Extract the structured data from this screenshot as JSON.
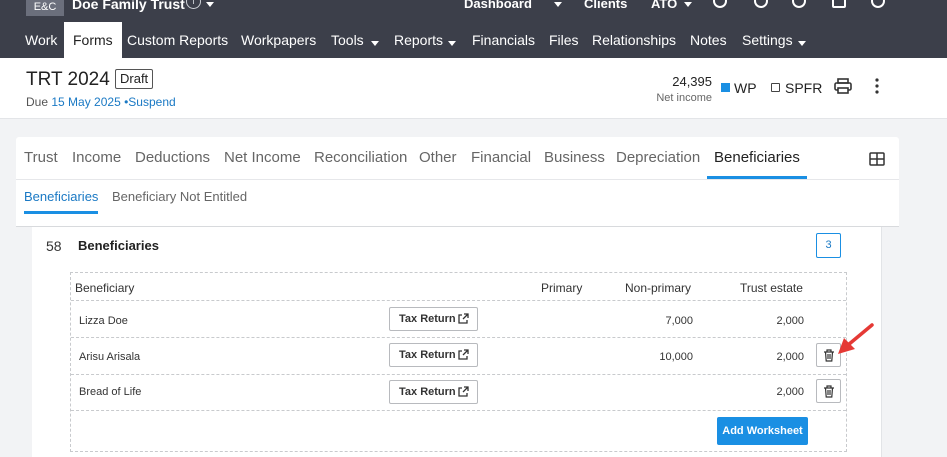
{
  "topbar": {
    "logo": "E&C",
    "client_name": "Doe Family Trust",
    "info_icon": "info-icon",
    "links": [
      "Dashboard",
      "Clients",
      "ATO"
    ]
  },
  "nav": {
    "items": [
      "Work",
      "Forms",
      "Custom Reports",
      "Workpapers",
      "Tools",
      "Reports",
      "Financials",
      "Files",
      "Relationships",
      "Notes",
      "Settings"
    ],
    "active": "Forms"
  },
  "header": {
    "title": "TRT 2024",
    "status": "Draft",
    "due_prefix": "Due",
    "due_date": "15 May 2025",
    "separator": "•",
    "suspend": "Suspend",
    "net_income_value": "24,395",
    "net_income_label": "Net income",
    "wp_label": "WP",
    "spfr_label": "SPFR",
    "accent_color": "#1a8fe3"
  },
  "tabs": {
    "items": [
      "Trust",
      "Income",
      "Deductions",
      "Net Income",
      "Reconciliation",
      "Other",
      "Financial",
      "Business",
      "Depreciation",
      "Beneficiaries"
    ],
    "active": "Beneficiaries"
  },
  "subtabs": {
    "items": [
      "Beneficiaries",
      "Beneficiary Not Entitled"
    ],
    "active": "Beneficiaries"
  },
  "section": {
    "number": "58",
    "title": "Beneficiaries",
    "count": "3",
    "columns": [
      "Beneficiary",
      "Primary",
      "Non-primary",
      "Trust estate"
    ],
    "rows": [
      {
        "name": "Lizza Doe",
        "button": "Tax Return",
        "primary": "",
        "non_primary": "7,000",
        "trust_estate": "2,000"
      },
      {
        "name": "Arisu Arisala",
        "button": "Tax Return",
        "primary": "",
        "non_primary": "10,000",
        "trust_estate": "2,000"
      },
      {
        "name": "Bread of Life",
        "button": "Tax Return",
        "primary": "",
        "non_primary": "",
        "trust_estate": "2,000"
      }
    ],
    "add_button": "Add Worksheet"
  }
}
